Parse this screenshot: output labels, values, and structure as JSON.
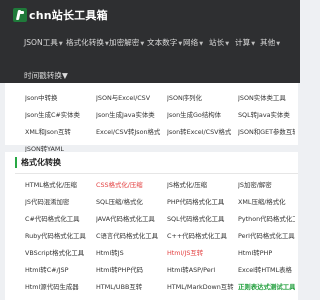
{
  "app": {
    "logo_text": "chn站长工具箱"
  },
  "nav": {
    "main": [
      "JSON工具",
      "格式化转换",
      "加密解密",
      "文本数字",
      "网络",
      "站长",
      "计算",
      "其他"
    ],
    "second": [
      "时间戳转换"
    ]
  },
  "json_tools": {
    "items": [
      "Json中转换",
      "JSON与Excel/CSV",
      "JSON序列化",
      "JSON实体类工具",
      "Json生成C#实体类",
      "Json生成Java实体类",
      "Json生成Go结构体",
      "SQL转Java实体类",
      "XML和Json互转",
      "Excel/CSV转Json格式",
      "Json转Excel/CSV格式",
      "JSON和GET参数互转",
      "JSON转YAML"
    ]
  },
  "format_section": {
    "title": "格式化转换",
    "items": [
      {
        "label": "HTML格式化/压缩",
        "style": "normal"
      },
      {
        "label": "CSS格式化/压缩",
        "style": "red"
      },
      {
        "label": "JS格式化/压缩",
        "style": "normal"
      },
      {
        "label": "JS加密/解密",
        "style": "normal"
      },
      {
        "label": "JS代码混淆加密",
        "style": "normal"
      },
      {
        "label": "SQL压缩/格式化",
        "style": "normal"
      },
      {
        "label": "PHP代码格式化工具",
        "style": "normal"
      },
      {
        "label": "XML压缩/格式化",
        "style": "normal"
      },
      {
        "label": "C#代码格式化工具",
        "style": "normal"
      },
      {
        "label": "JAVA代码格式化工具",
        "style": "normal"
      },
      {
        "label": "SQL代码格式化工具",
        "style": "normal"
      },
      {
        "label": "Python代码格式化工具",
        "style": "normal"
      },
      {
        "label": "Ruby代码格式化工具",
        "style": "normal"
      },
      {
        "label": "C语言代码格式化工具",
        "style": "normal"
      },
      {
        "label": "C++代码格式化工具",
        "style": "normal"
      },
      {
        "label": "Perl代码格式化工具",
        "style": "normal"
      },
      {
        "label": "VBScript格式化工具",
        "style": "normal"
      },
      {
        "label": "Html转JS",
        "style": "normal"
      },
      {
        "label": "Html/JS互转",
        "style": "red"
      },
      {
        "label": "Html转PHP",
        "style": "normal"
      },
      {
        "label": "Html转C#/JSP",
        "style": "normal"
      },
      {
        "label": "Html转PHP代码",
        "style": "normal"
      },
      {
        "label": "Html转ASP/Perl",
        "style": "normal"
      },
      {
        "label": "Excel转HTML表格",
        "style": "normal"
      },
      {
        "label": "Html源代码生成器",
        "style": "normal"
      },
      {
        "label": "HTML/UBB互转",
        "style": "normal"
      },
      {
        "label": "HTML/MarkDown互转",
        "style": "normal"
      },
      {
        "label": "正则表达式测试工具",
        "style": "green"
      }
    ]
  },
  "colors": {
    "header_bg": "#2e2f31",
    "accent_green": "#27a844",
    "highlight_red": "#e34141",
    "page_bg": "#eef0f3"
  }
}
